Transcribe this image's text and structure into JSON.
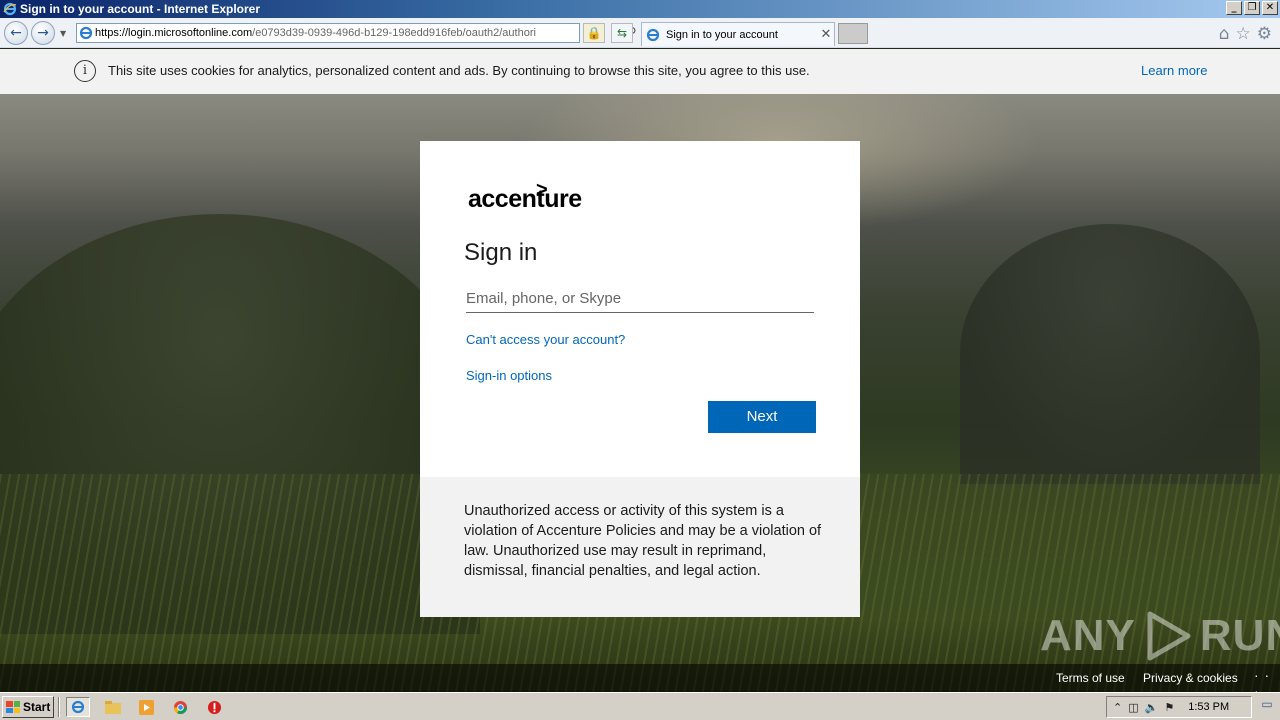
{
  "window": {
    "title": "Sign in to your account - Internet Explorer",
    "controls": [
      "_",
      "❐",
      "✕"
    ]
  },
  "browser": {
    "url_domain": "https://login.microsoftonline.com",
    "url_rest": "/e0793d39-0939-496d-b129-198edd916feb/oauth2/authori",
    "tab_title": "Sign in to your account"
  },
  "cookie_banner": {
    "message": "This site uses cookies for analytics, personalized content and ads. By continuing to browse this site, you agree to this use.",
    "learn_more": "Learn more"
  },
  "signin": {
    "logo_text": "accenture",
    "logo_mark": ">",
    "title": "Sign in",
    "email_placeholder": "Email, phone, or Skype",
    "email_value": "",
    "cant_access": "Can't access your account?",
    "signin_options": "Sign-in options",
    "next_label": "Next"
  },
  "notice": {
    "text": "Unauthorized access or activity of this system is a violation of Accenture Policies and may be a violation of law. Unauthorized use may result in reprimand, dismissal, financial penalties, and legal action."
  },
  "footer": {
    "terms": "Terms of use",
    "privacy": "Privacy & cookies",
    "more": "· · ·"
  },
  "watermark": {
    "left": "ANY",
    "right": "RUN"
  },
  "taskbar": {
    "start_label": "Start",
    "clock": "1:53 PM"
  },
  "colors": {
    "accent_blue": "#0067b8",
    "card_bg": "#ffffff",
    "notice_bg": "#f2f2f2"
  }
}
